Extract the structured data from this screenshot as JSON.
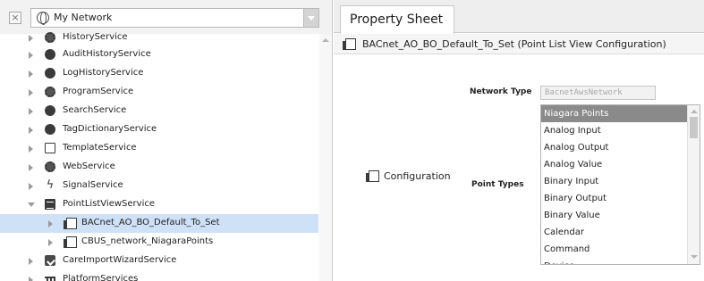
{
  "nav": {
    "close_label": "×",
    "network_selector": {
      "label": "My Network",
      "icon": "globe-icon"
    },
    "tree": [
      {
        "label": "HistoryService",
        "icon": "history-service-icon",
        "expanded": false
      },
      {
        "label": "AuditHistoryService",
        "icon": "audit-history-icon",
        "expanded": false
      },
      {
        "label": "LogHistoryService",
        "icon": "log-history-icon",
        "expanded": false
      },
      {
        "label": "ProgramService",
        "icon": "program-service-icon",
        "expanded": false
      },
      {
        "label": "SearchService",
        "icon": "search-service-icon",
        "expanded": false
      },
      {
        "label": "TagDictionaryService",
        "icon": "tag-dictionary-icon",
        "expanded": false
      },
      {
        "label": "TemplateService",
        "icon": "template-service-icon",
        "expanded": false
      },
      {
        "label": "WebService",
        "icon": "web-service-icon",
        "expanded": false
      },
      {
        "label": "SignalService",
        "icon": "signal-bolt-icon",
        "expanded": false
      },
      {
        "label": "PointListViewService",
        "icon": "point-list-view-icon",
        "expanded": true
      },
      {
        "label": "BACnet_AO_BO_Default_To_Set",
        "icon": "folder-icon",
        "expanded": false,
        "selected": true
      },
      {
        "label": "CBUS_network_NiagaraPoints",
        "icon": "folder-icon",
        "expanded": false
      },
      {
        "label": "CareImportWizardService",
        "icon": "wizard-icon",
        "expanded": false
      },
      {
        "label": "PlatformServices",
        "icon": "platform-services-icon",
        "expanded": false
      }
    ]
  },
  "sheet": {
    "tab_label": "Property Sheet",
    "header_title": "BACnet_AO_BO_Default_To_Set  (Point List View Configuration)",
    "configuration_label": "Configuration",
    "network_type_label": "Network Type",
    "network_type_value": "BacnetAwsNetwork",
    "point_types_label": "Point Types",
    "point_types": [
      "Niagara Points",
      "Analog Input",
      "Analog Output",
      "Analog Value",
      "Binary Input",
      "Binary Output",
      "Binary Value",
      "Calendar",
      "Command",
      "Device"
    ],
    "selected_point_type": "Niagara Points"
  },
  "colors": {
    "selection_highlight": "#cfe1f7",
    "list_selected": "#8a8a8a",
    "panel_header": "#f2f2f2"
  }
}
